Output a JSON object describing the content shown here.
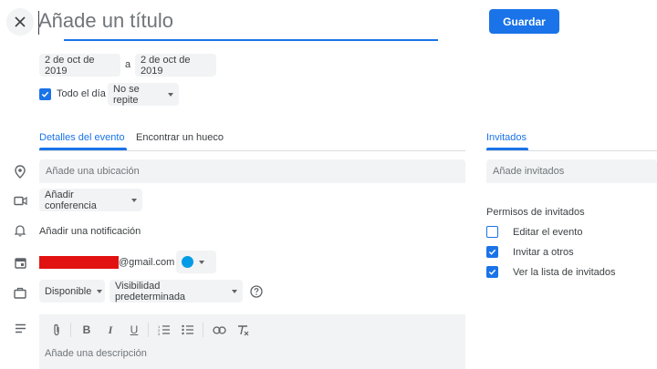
{
  "header": {
    "title_placeholder": "Añade un título",
    "save_label": "Guardar"
  },
  "dates": {
    "start": "2 de oct de 2019",
    "separator": "a",
    "end": "2 de oct de 2019"
  },
  "options": {
    "all_day_label": "Todo el día",
    "all_day_checked": true,
    "repeat_value": "No se repite"
  },
  "tabs": {
    "details": "Detalles del evento",
    "find_time": "Encontrar un hueco",
    "guests": "Invitados"
  },
  "details": {
    "location_placeholder": "Añade una ubicación",
    "conference_label": "Añadir conferencia",
    "notification_label": "Añadir una notificación",
    "calendar_email_suffix": "@gmail.com",
    "calendar_color": "#039be5",
    "availability": "Disponible",
    "visibility": "Visibilidad predeterminada",
    "description_placeholder": "Añade una descripción"
  },
  "guests": {
    "add_placeholder": "Añade invitados",
    "permissions_title": "Permisos de invitados",
    "permissions": [
      {
        "label": "Editar el evento",
        "checked": false
      },
      {
        "label": "Invitar a otros",
        "checked": true
      },
      {
        "label": "Ver la lista de invitados",
        "checked": true
      }
    ]
  },
  "colors": {
    "accent": "#1a73e8",
    "field_bg": "#f1f3f4",
    "redaction": "#e21212"
  }
}
